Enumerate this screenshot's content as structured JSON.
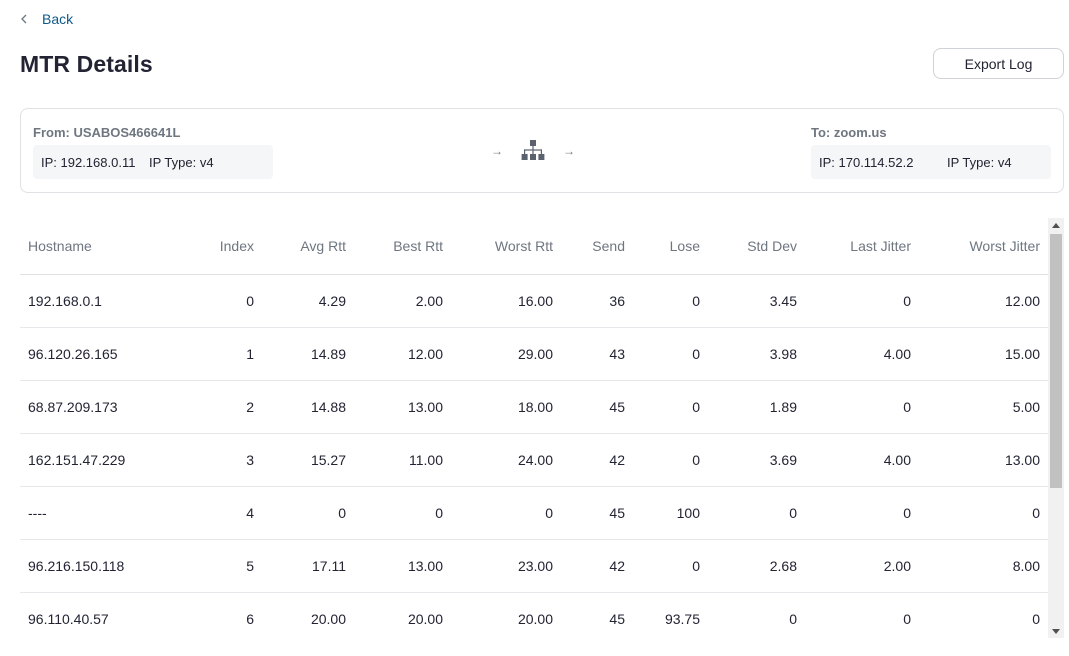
{
  "header": {
    "back_label": "Back",
    "title": "MTR Details",
    "export_label": "Export Log"
  },
  "route": {
    "from": {
      "title": "From: USABOS466641L",
      "ip": "IP: 192.168.0.11",
      "ip_type": "IP Type: v4"
    },
    "to": {
      "title": "To: zoom.us",
      "ip": "IP: 170.114.52.2",
      "ip_type": "IP Type: v4"
    },
    "arrow_glyph": "→",
    "icon": "network-topology-icon"
  },
  "table": {
    "columns": [
      "Hostname",
      "Index",
      "Avg Rtt",
      "Best Rtt",
      "Worst Rtt",
      "Send",
      "Lose",
      "Std Dev",
      "Last Jitter",
      "Worst Jitter"
    ],
    "rows": [
      [
        "192.168.0.1",
        "0",
        "4.29",
        "2.00",
        "16.00",
        "36",
        "0",
        "3.45",
        "0",
        "12.00"
      ],
      [
        "96.120.26.165",
        "1",
        "14.89",
        "12.00",
        "29.00",
        "43",
        "0",
        "3.98",
        "4.00",
        "15.00"
      ],
      [
        "68.87.209.173",
        "2",
        "14.88",
        "13.00",
        "18.00",
        "45",
        "0",
        "1.89",
        "0",
        "5.00"
      ],
      [
        "162.151.47.229",
        "3",
        "15.27",
        "11.00",
        "24.00",
        "42",
        "0",
        "3.69",
        "4.00",
        "13.00"
      ],
      [
        "----",
        "4",
        "0",
        "0",
        "0",
        "45",
        "100",
        "0",
        "0",
        "0"
      ],
      [
        "96.216.150.118",
        "5",
        "17.11",
        "13.00",
        "23.00",
        "42",
        "0",
        "2.68",
        "2.00",
        "8.00"
      ],
      [
        "96.110.40.57",
        "6",
        "20.00",
        "20.00",
        "20.00",
        "45",
        "93.75",
        "0",
        "0",
        "0"
      ]
    ]
  },
  "colors": {
    "link": "#0e5a8a",
    "text": "#232333",
    "muted": "#6e7680",
    "border": "#dfe1e5"
  }
}
